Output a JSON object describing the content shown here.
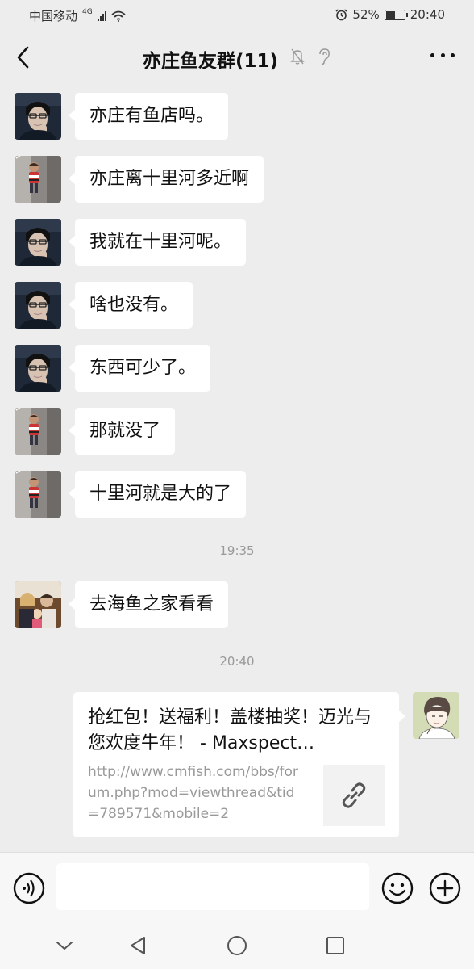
{
  "status_bar": {
    "carrier": "中国移动",
    "network": "4G",
    "battery": "52%",
    "battery_level": 0.52,
    "time": "20:40"
  },
  "nav": {
    "title": "亦庄鱼友群(11)",
    "back_icon": "chevron-left-icon",
    "mute_icon": "bell-off-icon",
    "earpiece_icon": "ear-icon",
    "more_icon": "more-dots-icon"
  },
  "messages": [
    {
      "avatar": "man-glasses-avatar",
      "text": "亦庄有鱼店吗。"
    },
    {
      "avatar": "child-avatar",
      "text": "亦庄离十里河多近啊"
    },
    {
      "avatar": "man-glasses-avatar",
      "text": "我就在十里河呢。"
    },
    {
      "avatar": "man-glasses-avatar",
      "text": "啥也没有。"
    },
    {
      "avatar": "man-glasses-avatar",
      "text": "东西可少了。"
    },
    {
      "avatar": "child-avatar",
      "text": "那就没了"
    },
    {
      "avatar": "child-avatar",
      "text": "十里河就是大的了"
    },
    {
      "avatar": "family-avatar",
      "text": "去海鱼之家看看"
    }
  ],
  "timestamps": [
    "19:35",
    "20:40"
  ],
  "link_card": {
    "title": "抢红包！送福利！盖楼抽奖！迈光与您欢度牛年！ - Maxspect…",
    "url": "http://www.cmfish.com/bbs/forum.php?mod=viewthread&tid=789571&mobile=2",
    "thumb_icon": "link-icon",
    "sender_avatar": "illustrated-boy-avatar"
  },
  "input_bar": {
    "voice_icon": "voice-icon",
    "text_value": "",
    "emoji_icon": "emoji-icon",
    "plus_icon": "plus-icon"
  },
  "system_nav": [
    "chevron-down-icon",
    "back-triangle-icon",
    "home-circle-icon",
    "recents-square-icon"
  ]
}
